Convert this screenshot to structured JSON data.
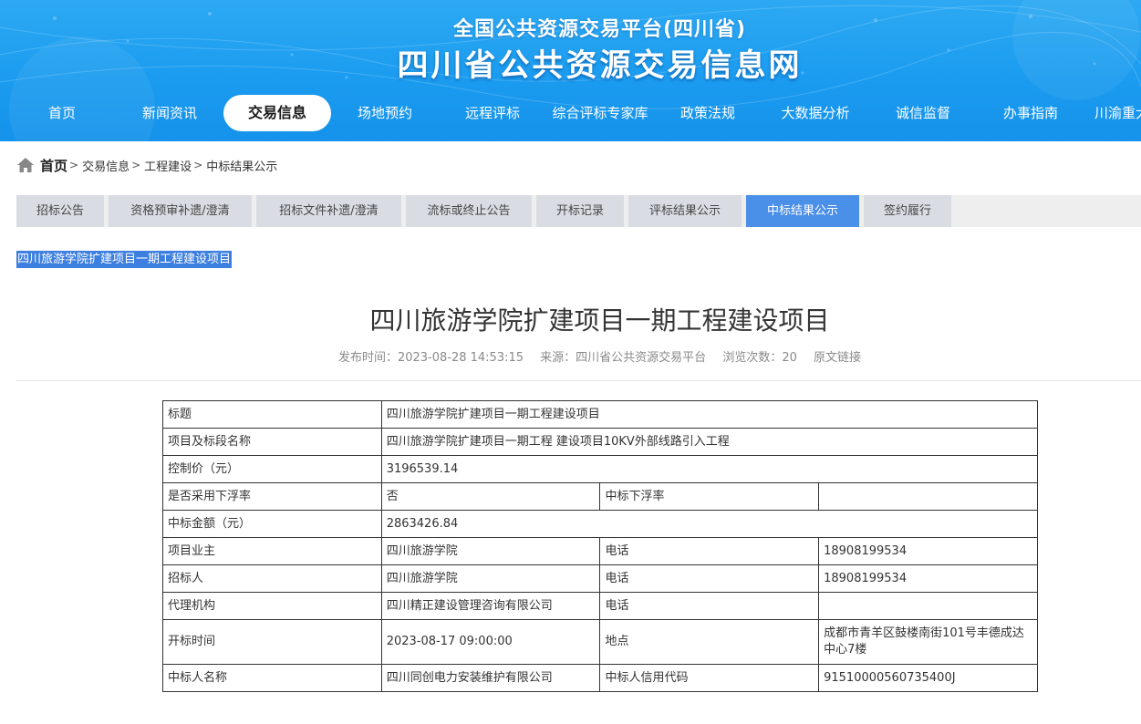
{
  "header": {
    "sub_title": "全国公共资源交易平台(四川省)",
    "main_title": "四川省公共资源交易信息网"
  },
  "nav": {
    "items": [
      {
        "label": "首页"
      },
      {
        "label": "新闻资讯"
      },
      {
        "label": "交易信息",
        "active": true
      },
      {
        "label": "场地预约"
      },
      {
        "label": "远程评标"
      },
      {
        "label": "综合评标专家库"
      },
      {
        "label": "政策法规"
      },
      {
        "label": "大数据分析"
      },
      {
        "label": "诚信监督"
      },
      {
        "label": "办事指南"
      },
      {
        "label": "川渝重大"
      }
    ]
  },
  "breadcrumb": {
    "home": "首页",
    "separator": ">",
    "items": [
      "交易信息",
      "工程建设",
      "中标结果公示"
    ]
  },
  "tabs": [
    {
      "label": "招标公告"
    },
    {
      "label": "资格预审补遗/澄清"
    },
    {
      "label": "招标文件补遗/澄清"
    },
    {
      "label": "流标或终止公告"
    },
    {
      "label": "开标记录"
    },
    {
      "label": "评标结果公示"
    },
    {
      "label": "中标结果公示",
      "active": true
    },
    {
      "label": "签约履行"
    }
  ],
  "selected_text": "四川旅游学院扩建项目一期工程建设项目",
  "article": {
    "title": "四川旅游学院扩建项目一期工程建设项目",
    "publish_time": "发布时间：2023-08-28 14:53:15",
    "source": "来源：四川省公共资源交易平台",
    "views": "浏览次数：20",
    "original_link": "原文链接"
  },
  "table": {
    "title_label": "标题",
    "title_value": "四川旅游学院扩建项目一期工程建设项目",
    "section_label": "项目及标段名称",
    "section_value": "四川旅游学院扩建项目一期工程 建设项目10KV外部线路引入工程",
    "control_price_label": "控制价（元）",
    "control_price_value": "3196539.14",
    "float_label": "是否采用下浮率",
    "float_value": "否",
    "win_float_label": "中标下浮率",
    "win_float_value": "",
    "win_amount_label": "中标金额（元）",
    "win_amount_value": "2863426.84",
    "owner_label": "项目业主",
    "owner_value": "四川旅游学院",
    "owner_phone_label": "电话",
    "owner_phone_value": "18908199534",
    "tenderer_label": "招标人",
    "tenderer_value": "四川旅游学院",
    "tenderer_phone_label": "电话",
    "tenderer_phone_value": "18908199534",
    "agent_label": "代理机构",
    "agent_value": "四川精正建设管理咨询有限公司",
    "agent_phone_label": "电话",
    "agent_phone_value": "",
    "open_time_label": "开标时间",
    "open_time_value": "2023-08-17 09:00:00",
    "location_label": "地点",
    "location_value": "成都市青羊区鼓楼南街101号丰德成达中心7楼",
    "winner_label": "中标人名称",
    "winner_value": "四川同创电力安装维护有限公司",
    "winner_code_label": "中标人信用代码",
    "winner_code_value": "91510000560735400J"
  }
}
